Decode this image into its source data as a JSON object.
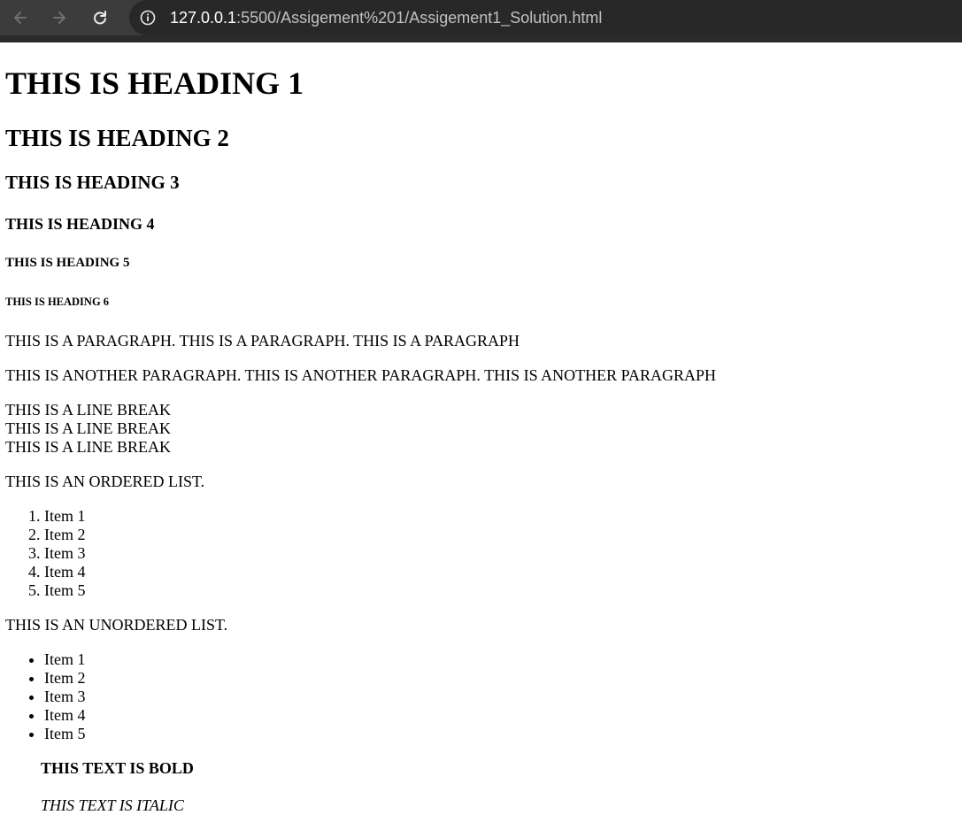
{
  "browser": {
    "url_host": "127.0.0.1",
    "url_path": ":5500/Assigement%201/Assigement1_Solution.html"
  },
  "page": {
    "h1": "THIS IS HEADING 1",
    "h2": "THIS IS HEADING 2",
    "h3": "THIS IS HEADING 3",
    "h4": "THIS IS HEADING 4",
    "h5": "THIS IS HEADING 5",
    "h6": "THIS IS HEADING 6",
    "paragraph1": "THIS IS A PARAGRAPH. THIS IS A PARAGRAPH. THIS IS A PARAGRAPH",
    "paragraph2": "THIS IS ANOTHER PARAGRAPH. THIS IS ANOTHER PARAGRAPH. THIS IS ANOTHER PARAGRAPH",
    "line_breaks": [
      "THIS IS A LINE BREAK",
      "THIS IS A LINE BREAK",
      "THIS IS A LINE BREAK"
    ],
    "ordered_intro": "THIS IS AN ORDERED LIST.",
    "ordered_items": [
      "Item 1",
      "Item 2",
      "Item 3",
      "Item 4",
      "Item 5"
    ],
    "unordered_intro": "THIS IS AN UNORDERED LIST.",
    "unordered_items": [
      "Item 1",
      "Item 2",
      "Item 3",
      "Item 4",
      "Item 5"
    ],
    "bold_text": "THIS TEXT IS BOLD",
    "italic_text": "THIS TEXT IS ITALIC"
  },
  "icons": {
    "back": "arrow-left-icon",
    "forward": "arrow-right-icon",
    "reload": "reload-icon",
    "info": "info-icon"
  },
  "colors": {
    "toolbar": "#3c3c3c",
    "omnibox": "#282828",
    "page_background": "#ffffff"
  }
}
